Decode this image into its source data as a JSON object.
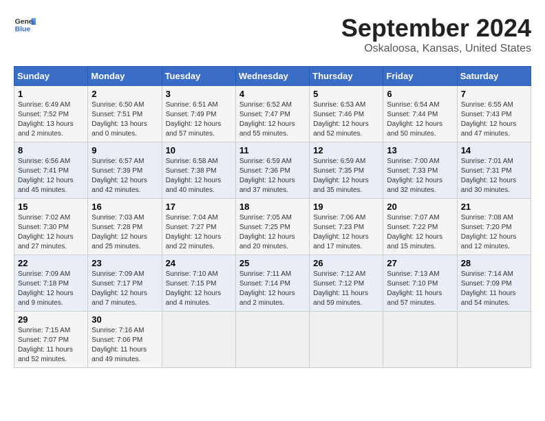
{
  "header": {
    "logo_line1": "General",
    "logo_line2": "Blue",
    "month_title": "September 2024",
    "location": "Oskaloosa, Kansas, United States"
  },
  "days_of_week": [
    "Sunday",
    "Monday",
    "Tuesday",
    "Wednesday",
    "Thursday",
    "Friday",
    "Saturday"
  ],
  "weeks": [
    [
      {
        "num": "1",
        "rise": "6:49 AM",
        "set": "7:52 PM",
        "daylight": "13 hours and 2 minutes."
      },
      {
        "num": "2",
        "rise": "6:50 AM",
        "set": "7:51 PM",
        "daylight": "13 hours and 0 minutes."
      },
      {
        "num": "3",
        "rise": "6:51 AM",
        "set": "7:49 PM",
        "daylight": "12 hours and 57 minutes."
      },
      {
        "num": "4",
        "rise": "6:52 AM",
        "set": "7:47 PM",
        "daylight": "12 hours and 55 minutes."
      },
      {
        "num": "5",
        "rise": "6:53 AM",
        "set": "7:46 PM",
        "daylight": "12 hours and 52 minutes."
      },
      {
        "num": "6",
        "rise": "6:54 AM",
        "set": "7:44 PM",
        "daylight": "12 hours and 50 minutes."
      },
      {
        "num": "7",
        "rise": "6:55 AM",
        "set": "7:43 PM",
        "daylight": "12 hours and 47 minutes."
      }
    ],
    [
      {
        "num": "8",
        "rise": "6:56 AM",
        "set": "7:41 PM",
        "daylight": "12 hours and 45 minutes."
      },
      {
        "num": "9",
        "rise": "6:57 AM",
        "set": "7:39 PM",
        "daylight": "12 hours and 42 minutes."
      },
      {
        "num": "10",
        "rise": "6:58 AM",
        "set": "7:38 PM",
        "daylight": "12 hours and 40 minutes."
      },
      {
        "num": "11",
        "rise": "6:59 AM",
        "set": "7:36 PM",
        "daylight": "12 hours and 37 minutes."
      },
      {
        "num": "12",
        "rise": "6:59 AM",
        "set": "7:35 PM",
        "daylight": "12 hours and 35 minutes."
      },
      {
        "num": "13",
        "rise": "7:00 AM",
        "set": "7:33 PM",
        "daylight": "12 hours and 32 minutes."
      },
      {
        "num": "14",
        "rise": "7:01 AM",
        "set": "7:31 PM",
        "daylight": "12 hours and 30 minutes."
      }
    ],
    [
      {
        "num": "15",
        "rise": "7:02 AM",
        "set": "7:30 PM",
        "daylight": "12 hours and 27 minutes."
      },
      {
        "num": "16",
        "rise": "7:03 AM",
        "set": "7:28 PM",
        "daylight": "12 hours and 25 minutes."
      },
      {
        "num": "17",
        "rise": "7:04 AM",
        "set": "7:27 PM",
        "daylight": "12 hours and 22 minutes."
      },
      {
        "num": "18",
        "rise": "7:05 AM",
        "set": "7:25 PM",
        "daylight": "12 hours and 20 minutes."
      },
      {
        "num": "19",
        "rise": "7:06 AM",
        "set": "7:23 PM",
        "daylight": "12 hours and 17 minutes."
      },
      {
        "num": "20",
        "rise": "7:07 AM",
        "set": "7:22 PM",
        "daylight": "12 hours and 15 minutes."
      },
      {
        "num": "21",
        "rise": "7:08 AM",
        "set": "7:20 PM",
        "daylight": "12 hours and 12 minutes."
      }
    ],
    [
      {
        "num": "22",
        "rise": "7:09 AM",
        "set": "7:18 PM",
        "daylight": "12 hours and 9 minutes."
      },
      {
        "num": "23",
        "rise": "7:09 AM",
        "set": "7:17 PM",
        "daylight": "12 hours and 7 minutes."
      },
      {
        "num": "24",
        "rise": "7:10 AM",
        "set": "7:15 PM",
        "daylight": "12 hours and 4 minutes."
      },
      {
        "num": "25",
        "rise": "7:11 AM",
        "set": "7:14 PM",
        "daylight": "12 hours and 2 minutes."
      },
      {
        "num": "26",
        "rise": "7:12 AM",
        "set": "7:12 PM",
        "daylight": "11 hours and 59 minutes."
      },
      {
        "num": "27",
        "rise": "7:13 AM",
        "set": "7:10 PM",
        "daylight": "11 hours and 57 minutes."
      },
      {
        "num": "28",
        "rise": "7:14 AM",
        "set": "7:09 PM",
        "daylight": "11 hours and 54 minutes."
      }
    ],
    [
      {
        "num": "29",
        "rise": "7:15 AM",
        "set": "7:07 PM",
        "daylight": "11 hours and 52 minutes."
      },
      {
        "num": "30",
        "rise": "7:16 AM",
        "set": "7:06 PM",
        "daylight": "11 hours and 49 minutes."
      },
      null,
      null,
      null,
      null,
      null
    ]
  ],
  "labels": {
    "sunrise": "Sunrise:",
    "sunset": "Sunset:",
    "daylight": "Daylight:"
  }
}
